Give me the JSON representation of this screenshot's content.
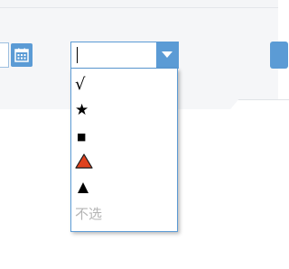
{
  "combo": {
    "value": "",
    "options": [
      {
        "glyph": "√",
        "icon": "check-mark"
      },
      {
        "glyph": "★",
        "icon": "black-star"
      },
      {
        "glyph": "■",
        "icon": "black-square"
      },
      {
        "glyph": "",
        "icon": "red-triangle",
        "color": "#e0421e"
      },
      {
        "glyph": "",
        "icon": "black-triangle",
        "color": "#000000"
      },
      {
        "glyph": "不选",
        "icon": "none"
      }
    ]
  },
  "colors": {
    "accent": "#5b9bd5",
    "panel": "#f5f6f8",
    "muted_text": "#b4b4b4"
  }
}
